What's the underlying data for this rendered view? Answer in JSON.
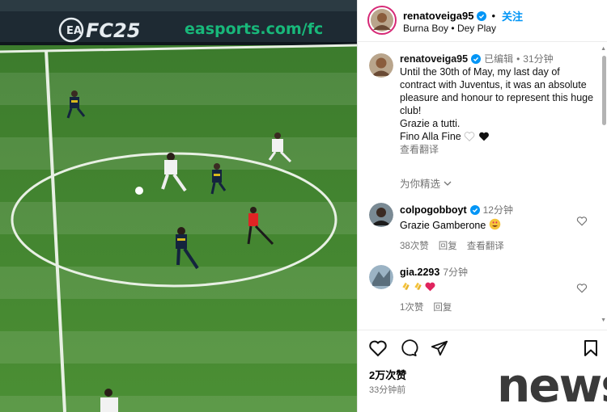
{
  "media": {
    "banner_brand": "FC25",
    "banner_url": "easports.com/fc"
  },
  "header": {
    "username": "renatoveiga95",
    "follow_label": "关注",
    "music_artist": "Burna Boy",
    "music_separator": "•",
    "music_track": "Dey Play"
  },
  "caption": {
    "username": "renatoveiga95",
    "edited_label": "已编辑",
    "separator": "•",
    "time": "31分钟",
    "text": "Until the 30th of May, my last day of contract with Juventus, it was an absolute pleasure and honour to represent this huge club!\nGrazie a tutti.\nFino Alla Fine",
    "see_translation": "查看翻译"
  },
  "selected_for_you": "为你精选",
  "comments": [
    {
      "username": "colpogobboyt",
      "time": "12分钟",
      "text": "Grazie Gamberone",
      "likes": "38次赞",
      "reply": "回复",
      "see_translation": "查看翻译"
    },
    {
      "username": "gia.2293",
      "time": "7分钟",
      "text": "",
      "likes": "1次赞",
      "reply": "回复"
    }
  ],
  "footer": {
    "likes_count": "2万次赞",
    "posted_ago": "33分钟前"
  },
  "watermark": "news",
  "colors": {
    "accent": "#0095f6",
    "muted": "#737373",
    "heart": "#ed4956",
    "pitch": "#3d7f2e"
  }
}
